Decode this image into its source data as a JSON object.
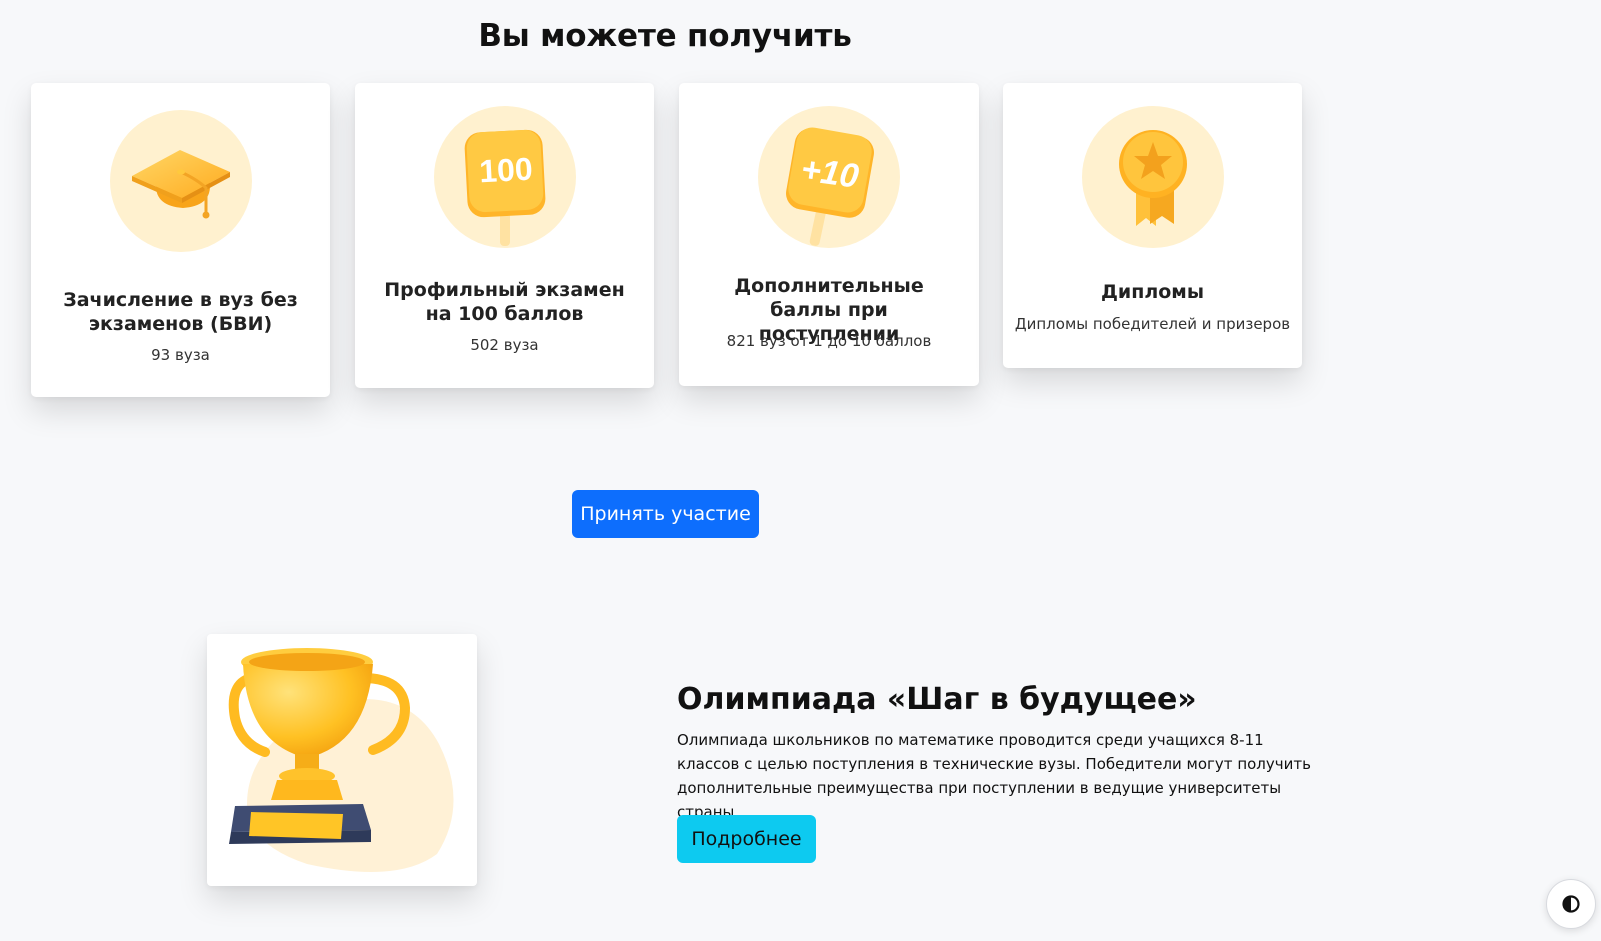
{
  "section": {
    "title": "Вы можете получить"
  },
  "cards": [
    {
      "title": "Зачисление в вуз без экзаменов (БВИ)",
      "text": "93 вуза",
      "icon": "graduation-cap-icon"
    },
    {
      "title": "Профильный экзамен на 100 баллов",
      "text": "502 вуза",
      "icon": "score-100-sign-icon",
      "badge": "100"
    },
    {
      "title": "Дополнительные баллы при поступлении",
      "text": "821 вуз от 1 до 10 баллов",
      "icon": "plus-10-sign-icon",
      "badge": "+10"
    },
    {
      "title": "Дипломы",
      "text": "Дипломы победителей и призеров",
      "icon": "medal-icon"
    }
  ],
  "actions": {
    "participate_label": "Принять участие"
  },
  "olympiad": {
    "title": "Олимпиада «Шаг в будущее»",
    "description": "Олимпиада школьников по математике проводится среди учащихся 8-11 классов с целью поступления в технические вузы. Победители могут получить дополнительные преимущества при поступлении в ведущие университеты страны.",
    "more_label": "Подробнее",
    "image_icon": "trophy-icon"
  },
  "theme_toggle": {
    "icon": "contrast-icon"
  },
  "colors": {
    "primary": "#0d6efd",
    "info": "#0dcaf0",
    "icon_bg": "#fff1cf",
    "accent_gold": "#ffbd2e",
    "background": "#f7f8fa"
  }
}
